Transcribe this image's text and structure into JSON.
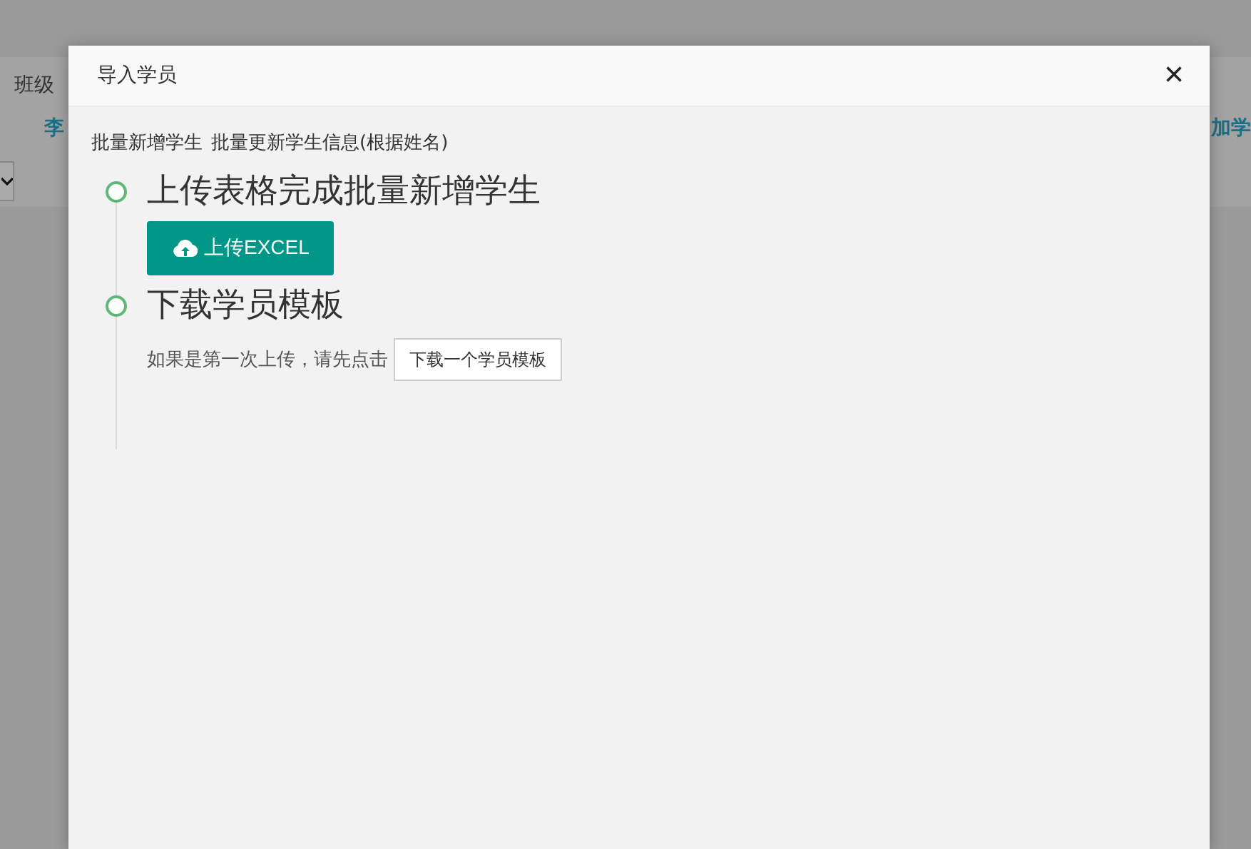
{
  "background": {
    "title": "班级",
    "row_link": "李",
    "action_link": "加学"
  },
  "dialog": {
    "title": "导入学员",
    "close": "×",
    "links": [
      "批量新增学生",
      "批量更新学生信息(根据姓名)"
    ],
    "steps": [
      {
        "kind": "upload",
        "title": "上传表格完成批量新增学生",
        "button": "上传EXCEL"
      },
      {
        "kind": "download",
        "title": "下载学员模板",
        "text": "如果是第一次上传，请先点击",
        "button": "下载一个学员模板"
      }
    ]
  }
}
